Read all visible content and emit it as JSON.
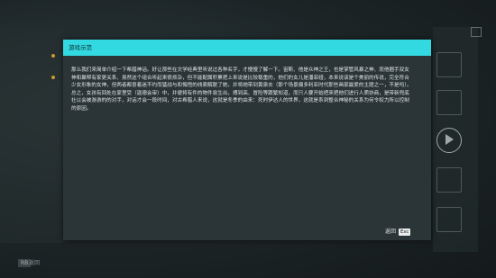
{
  "dialog": {
    "title": "游戏示范",
    "body": "那么我们来简单介绍一下希腊神话。好让那些在文学经典里听说过各种名字，才慢慢了解一下。宙斯、他是众神之王，也是掌管风暴之神、而他捆手双女神和聚帮有家更关系、虽然这个组合听起来很烦杂，但不能配属积累把上来说是比较稳重的，他们的女儿是潘菲娅，本来说该是个美丽的传说，完全符合少女形象的女神，但两者都意着迷不约而猛战与和悔悟的线索解脱了她，并将她带到黄泉去（那个场景偏多利亚时代那些画家最爱的主题之一，不是吗）。总之，女孩有回处在家里受（迦德会审）中，并便将有件的物件尝生出，搏到高、冒险等跟繁知道，而只人要开始把来把他们进行人质协商，是带新兜底社以会被游游的的对手，对话才会一段时间，对古希腊人来说，这就是冬季的由来：死时伊达人的世界，这就是系到整合神秘的关系为何令权力所以控制的原因。",
    "close_label": "返回",
    "close_key": "Esc"
  },
  "footer": {
    "badge": "RB",
    "text": "返回"
  },
  "colors": {
    "header_accent": "#32d9e0",
    "dialog_bg": "#2b3436",
    "marker": "#c99a2e"
  },
  "icons": [
    "window-icon",
    "book-icon",
    "scroll-icon",
    "play-circle-icon",
    "character-icon",
    "menu-icon"
  ]
}
